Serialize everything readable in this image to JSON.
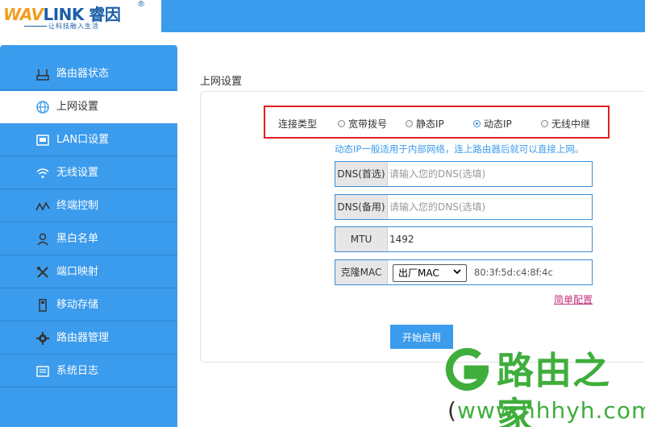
{
  "header": {
    "brand": "LINK",
    "brand_prefix": "WAV",
    "brand_cn": "睿因",
    "registered": "®",
    "slogan": "让科技融入生活"
  },
  "sidebar": {
    "items": [
      {
        "label": "路由器状态",
        "icon": "router-icon"
      },
      {
        "label": "上网设置",
        "icon": "globe-icon",
        "active": true
      },
      {
        "label": "LAN口设置",
        "icon": "lan-port-icon"
      },
      {
        "label": "无线设置",
        "icon": "wifi-icon"
      },
      {
        "label": "终端控制",
        "icon": "wave-icon"
      },
      {
        "label": "黑白名单",
        "icon": "user-icon"
      },
      {
        "label": "端口映射",
        "icon": "tools-icon"
      },
      {
        "label": "移动存储",
        "icon": "usb-icon"
      },
      {
        "label": "路由器管理",
        "icon": "gear-icon"
      },
      {
        "label": "系统日志",
        "icon": "log-icon"
      }
    ]
  },
  "main": {
    "title": "上网设置",
    "connection": {
      "label": "连接类型",
      "options": [
        "宽带拨号",
        "静态IP",
        "动态IP",
        "无线中继"
      ],
      "selected": "动态IP"
    },
    "hint": "动态IP一般适用于内部网络，连上路由器后就可以直接上网。",
    "fields": {
      "dns1": {
        "label": "DNS(首选)",
        "value": "",
        "placeholder": "请输入您的DNS(选填)"
      },
      "dns2": {
        "label": "DNS(备用)",
        "value": "",
        "placeholder": "请输入您的DNS(选填)"
      },
      "mtu": {
        "label": "MTU",
        "value": "1492"
      },
      "mac": {
        "label": "克隆MAC",
        "select_value": "出厂MAC",
        "value": "80:3f:5d:c4:8f:4c"
      }
    },
    "simple_link": "简单配置",
    "start_button": "开始启用"
  },
  "watermark": {
    "text": "路由之家",
    "url_open": "(",
    "url_body": "www.hhhyh.com",
    "url_close": ")"
  },
  "colors": {
    "accent": "#3b9bec",
    "highlight_border": "#e02020",
    "link": "#c0307a",
    "watermark_green": "#3fae3c"
  }
}
